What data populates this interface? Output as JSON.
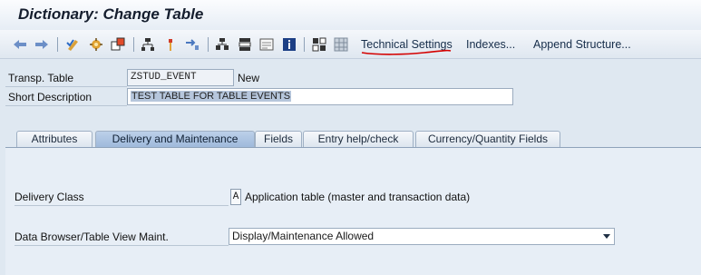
{
  "window": {
    "title": "Dictionary: Change Table"
  },
  "toolbar": {
    "icons": [
      "back-arrow-icon",
      "forward-arrow-icon",
      "other-object-icon",
      "display-change-icon",
      "activate-icon",
      "where-used-icon",
      "object-list-icon",
      "navigate-icon",
      "hierarchy-icon",
      "display-object-list-icon",
      "layout-icon",
      "info-icon",
      "contents-icon",
      "grid-icon"
    ],
    "technical_settings": "Technical Settings",
    "indexes": "Indexes...",
    "append_structure": "Append Structure...",
    "annotation_color": "#d40000"
  },
  "header": {
    "transp_table_label": "Transp. Table",
    "transp_table_value": "ZSTUD_EVENT",
    "status": "New",
    "short_desc_label": "Short Description",
    "short_desc_value": "TEST TABLE FOR TABLE  EVENTS"
  },
  "tabs": [
    {
      "label": "Attributes",
      "active": false
    },
    {
      "label": "Delivery and Maintenance",
      "active": true
    },
    {
      "label": "Fields",
      "active": false
    },
    {
      "label": "Entry help/check",
      "active": false
    },
    {
      "label": "Currency/Quantity Fields",
      "active": false
    }
  ],
  "delivery": {
    "delivery_class_label": "Delivery Class",
    "delivery_class_key": "A",
    "delivery_class_text": "Application table (master and transaction data)",
    "browser_label": "Data Browser/Table View Maint.",
    "browser_value": "Display/Maintenance Allowed"
  },
  "colors": {
    "active_tab": "#a9c2e0",
    "panel": "#e7eef6",
    "title": "#151e2e"
  }
}
